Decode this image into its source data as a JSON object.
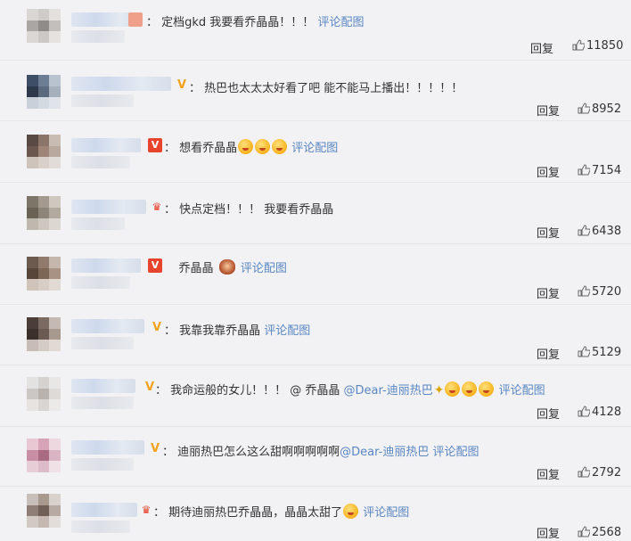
{
  "comments": [
    {
      "text": "定档gkd 我要看乔晶晶！！！",
      "link": "评论配图",
      "reply": "回复",
      "likes": "11850"
    },
    {
      "text": "热巴也太太太好看了吧 能不能马上播出！！！！！",
      "link": "",
      "reply": "回复",
      "likes": "8952"
    },
    {
      "text": "想看乔晶晶",
      "link": "评论配图",
      "reply": "回复",
      "likes": "7154"
    },
    {
      "text": "快点定档！！！ 我要看乔晶晶",
      "link": "",
      "reply": "回复",
      "likes": "6438"
    },
    {
      "text": "乔晶晶",
      "link": "评论配图",
      "reply": "回复",
      "likes": "5720"
    },
    {
      "text": "我靠我靠乔晶晶",
      "link": "评论配图",
      "reply": "回复",
      "likes": "5129"
    },
    {
      "text": "我命运般的女儿！！！ @ 乔晶晶 ",
      "mention": "@Dear-迪丽热巴",
      "link": "评论配图",
      "reply": "回复",
      "likes": "4128"
    },
    {
      "text": "迪丽热巴怎么这么甜啊啊啊啊啊",
      "mention": "@Dear-迪丽热巴",
      "link": "评论配图",
      "reply": "回复",
      "likes": "2792"
    },
    {
      "text": "期待迪丽热巴乔晶晶，晶晶太甜了",
      "link": "评论配图",
      "reply": "回复",
      "likes": "2568"
    }
  ],
  "colors": {
    "link": "#5a86c1",
    "vip_gold": "#f2a21b",
    "vip_red": "#e8432c"
  },
  "icons": {
    "like": "thumbs-up-icon",
    "vip": "v-badge-icon",
    "crown": "crown-badge-icon"
  }
}
